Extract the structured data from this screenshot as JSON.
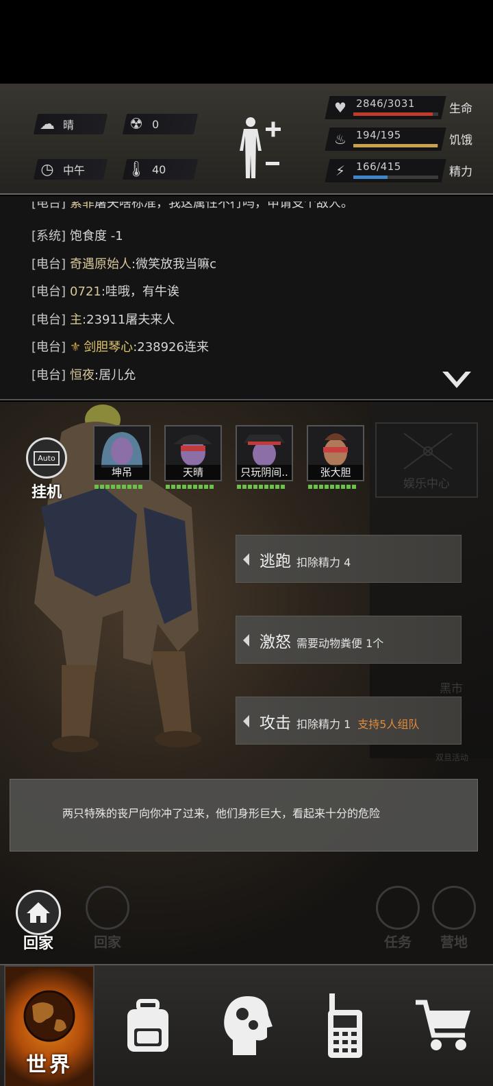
{
  "hud": {
    "weather": "晴",
    "radiation": "0",
    "time_of_day": "中午",
    "temperature": "40",
    "stats": [
      {
        "label": "生命",
        "value": "2846/3031",
        "fraction": 0.939,
        "color": "#c23b2a",
        "icon": "heart-icon"
      },
      {
        "label": "饥饿",
        "value": "194/195",
        "fraction": 0.995,
        "color": "#c9a24a",
        "icon": "stomach-icon"
      },
      {
        "label": "精力",
        "value": "166/415",
        "fraction": 0.4,
        "color": "#3f87c9",
        "icon": "brain-energy-icon"
      }
    ]
  },
  "chat": {
    "lines": [
      {
        "channel": "[电台]",
        "name": "紫菲",
        "text": "屠夫啥标准，我这属性不行吗，申请支个敌人。"
      },
      {
        "channel": "[系统]",
        "name": "",
        "text": "饱食度 -1"
      },
      {
        "channel": "[电台]",
        "name": "奇遇原始人",
        "text": ":微笑放我当嘛c"
      },
      {
        "channel": "[电台]",
        "name": "0721",
        "text": ":哇哦，有牛诶"
      },
      {
        "channel": "[电台]",
        "name": "主",
        "text": ":23911屠夫来人"
      },
      {
        "channel": "[电台]",
        "name": "剑胆琴心",
        "text": ":238926连来"
      },
      {
        "channel": "[电台]",
        "name": "恒夜",
        "text": ":居儿允"
      }
    ]
  },
  "battle": {
    "auto_label": "挂机",
    "auto_icon_text": "Auto",
    "party": [
      {
        "name": "坤吊"
      },
      {
        "name": "天晴"
      },
      {
        "name": "只玩阴间.."
      },
      {
        "name": "张大胆"
      }
    ],
    "entertainment_label": "娱乐中心",
    "black_market_label": "黑市",
    "double_event_label": "双旦活动",
    "actions": [
      {
        "name": "逃跑",
        "cost": "扣除精力 4",
        "extra": ""
      },
      {
        "name": "激怒",
        "cost": "需要动物粪便 1个",
        "extra": ""
      },
      {
        "name": "攻击",
        "cost": "扣除精力 1",
        "extra": "支持5人组队"
      }
    ],
    "story_text": "两只特殊的丧尸向你冲了过来，他们身形巨大，看起来十分的危险",
    "home_label": "回家",
    "ghost_home_label": "回家",
    "task_label": "任务",
    "camp_label": "营地"
  },
  "nav": {
    "world_label": "世界"
  }
}
